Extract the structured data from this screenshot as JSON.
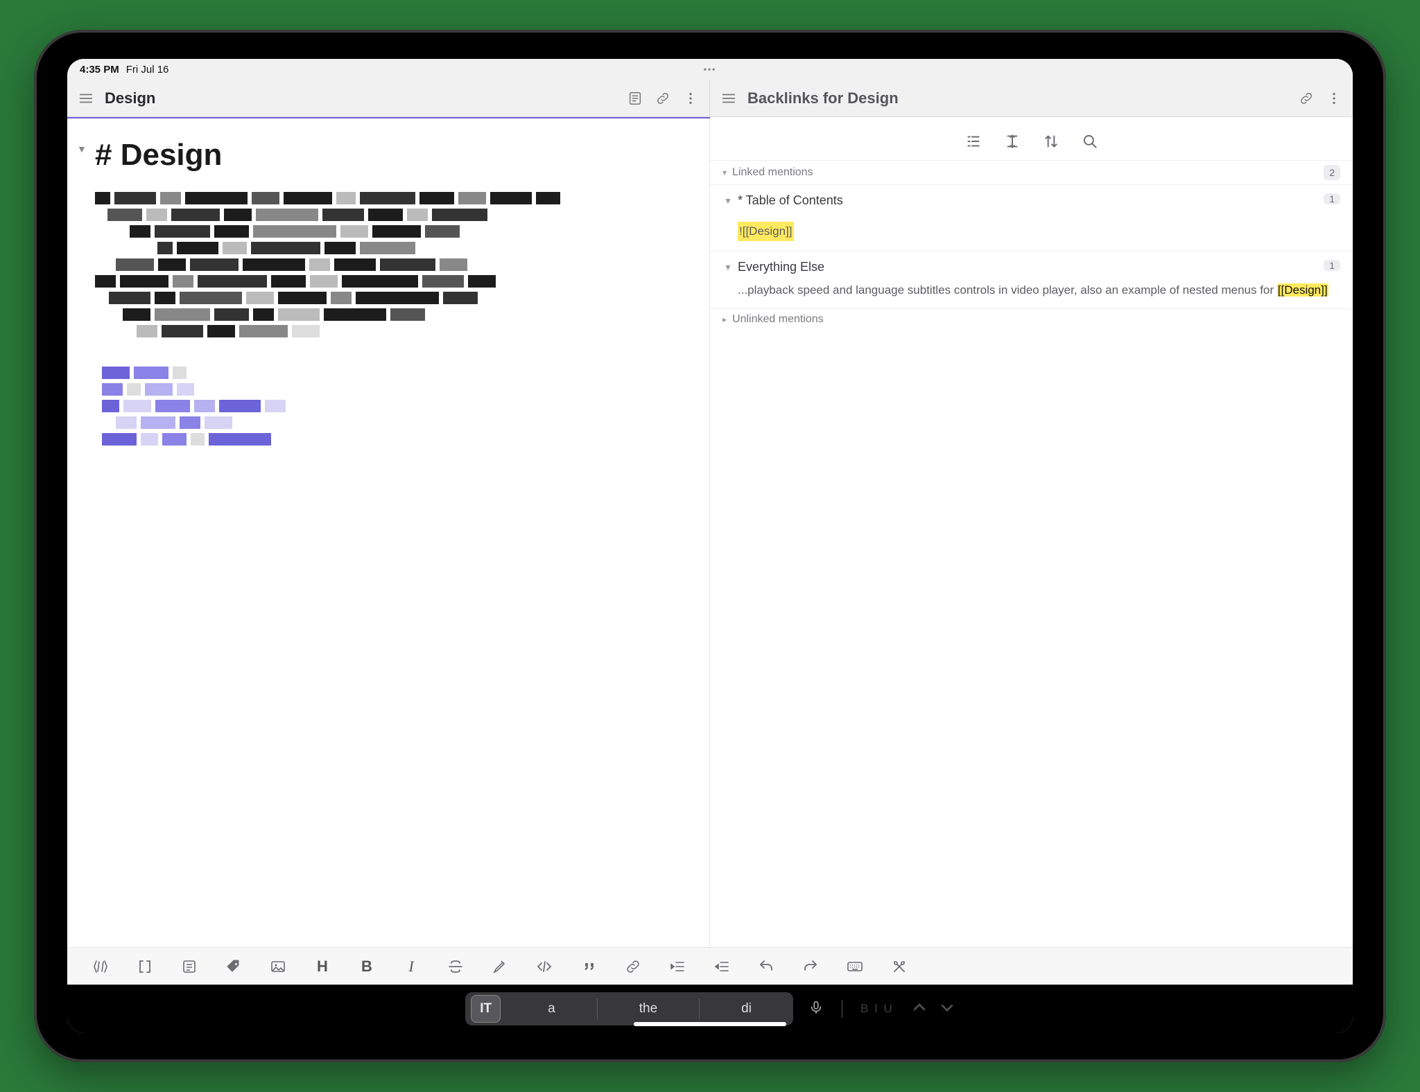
{
  "status": {
    "time": "4:35 PM",
    "date": "Fri Jul 16",
    "handle": "•••"
  },
  "left_pane": {
    "header_title": "Design",
    "doc_heading": "# Design"
  },
  "right_pane": {
    "header_title": "Backlinks for Design",
    "sections": {
      "linked": {
        "label": "Linked mentions",
        "count": "2"
      },
      "unlinked": {
        "label": "Unlinked mentions"
      }
    },
    "items": [
      {
        "title": "* Table of Contents",
        "count": "1",
        "embed_text": "![[Design]]"
      },
      {
        "title": "Everything Else",
        "count": "1",
        "body_prefix": "...playback speed and language subtitles controls in video player, also an example of nested menus for ",
        "body_hl": "[[Design]]"
      }
    ]
  },
  "quicktype": {
    "lang": "IT",
    "s1": "a",
    "s2": "the",
    "s3": "di",
    "biu": "B I U"
  },
  "colors": {
    "accent": "#6c63d8",
    "highlight": "#ffe95e"
  }
}
